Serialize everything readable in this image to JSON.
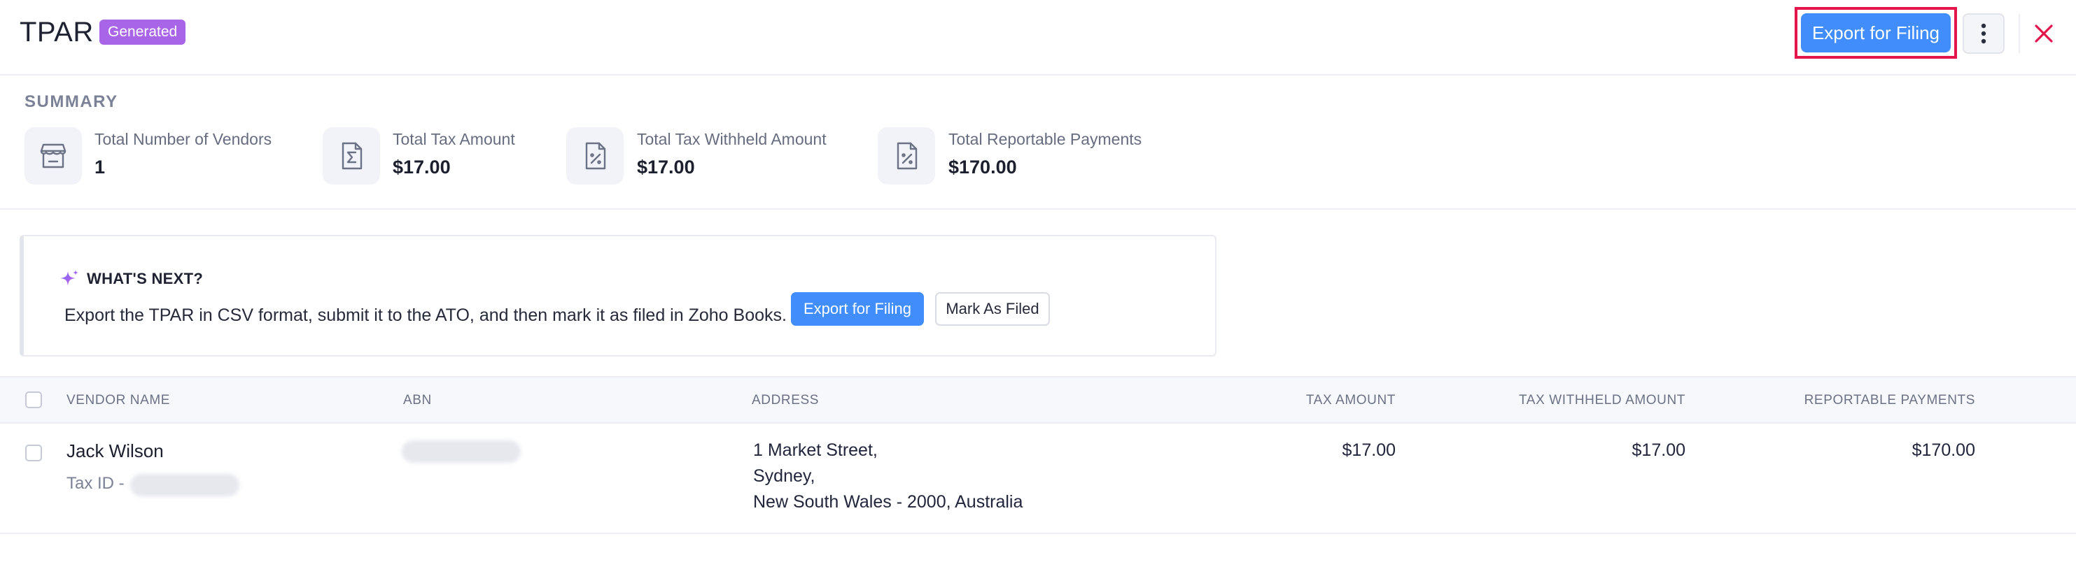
{
  "header": {
    "title": "TPAR",
    "status_badge": "Generated",
    "export_button": "Export for Filing",
    "more_icon": "kebab-vertical-icon",
    "close_icon": "close-icon",
    "accent_color": "#408dfb",
    "close_color": "#e3154a"
  },
  "summary": {
    "section_label": "SUMMARY",
    "stats": [
      {
        "label": "Total Number of Vendors",
        "value": "1",
        "icon": "store-icon"
      },
      {
        "label": "Total Tax Amount",
        "value": "$17.00",
        "icon": "sigma-document-icon"
      },
      {
        "label": "Total Tax Withheld Amount",
        "value": "$17.00",
        "icon": "percent-document-icon"
      },
      {
        "label": "Total Reportable Payments",
        "value": "$170.00",
        "icon": "percent-document-icon"
      }
    ]
  },
  "whats_next": {
    "title": "WHAT'S NEXT?",
    "icon": "sparkle-icon",
    "text": "Export the TPAR in CSV format, submit it to the ATO, and then mark it as filed in Zoho Books.",
    "export_button": "Export for Filing",
    "mark_button": "Mark As Filed"
  },
  "table": {
    "columns": [
      "VENDOR NAME",
      "ABN",
      "ADDRESS",
      "TAX AMOUNT",
      "TAX WITHHELD AMOUNT",
      "REPORTABLE PAYMENTS"
    ],
    "rows": [
      {
        "vendor_name": "Jack Wilson",
        "tax_id_label": "Tax ID -",
        "address_line1": "1 Market Street,",
        "address_line2": "Sydney,",
        "address_line3": "New South Wales - 2000, Australia",
        "tax_amount": "$17.00",
        "tax_withheld": "$17.00",
        "reportable_payments": "$170.00"
      }
    ]
  }
}
